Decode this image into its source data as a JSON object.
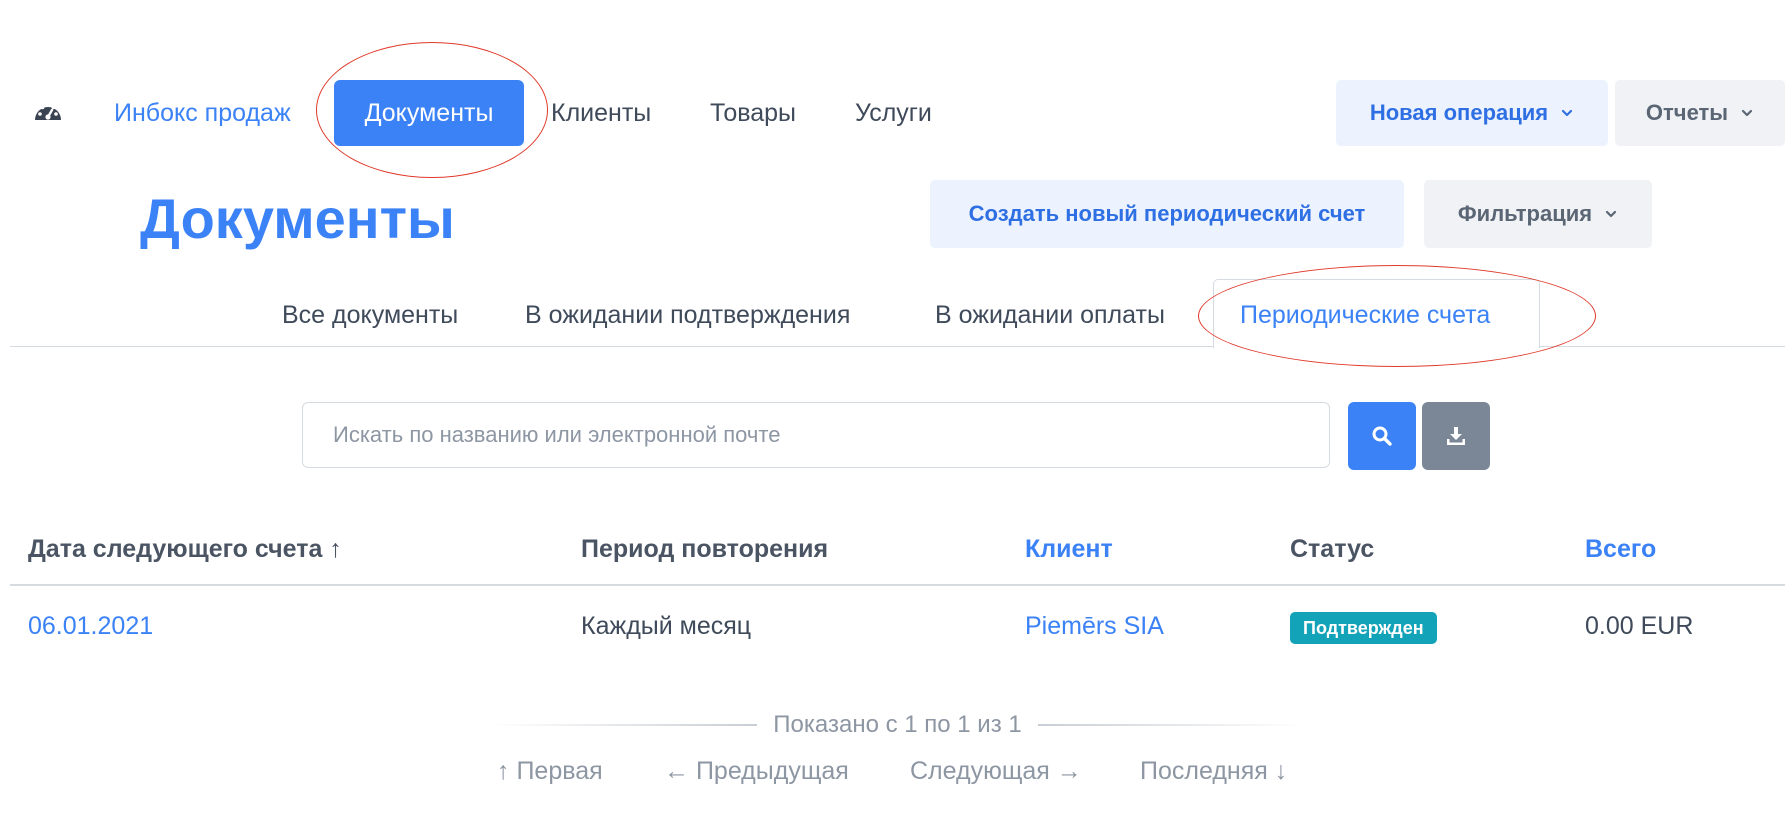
{
  "nav": {
    "dashboard_icon": "speedometer-icon",
    "sales_inbox": "Инбокс продаж",
    "documents": "Документы",
    "clients": "Клиенты",
    "products": "Товары",
    "services": "Услуги",
    "new_operation": "Новая операция",
    "reports": "Отчеты"
  },
  "page": {
    "title": "Документы",
    "create_button": "Создать новый периодический счет",
    "filter_button": "Фильтрация"
  },
  "tabs": [
    {
      "label": "Все документы"
    },
    {
      "label": "В ожидании подтверждения"
    },
    {
      "label": "В ожидании оплаты"
    },
    {
      "label": "Периодические счета",
      "active": true
    }
  ],
  "search": {
    "placeholder": "Искать по названию или электронной почте",
    "search_icon": "magnifier-icon",
    "download_icon": "download-icon"
  },
  "table": {
    "headers": [
      "Дата следующего счета ↑",
      "Период повторения",
      "Клиент",
      "Статус",
      "Всего"
    ],
    "rows": [
      {
        "date": "06.01.2021",
        "period": "Каждый месяц",
        "client": "Piemērs SIA",
        "status": "Подтвержден",
        "total": "0.00 EUR"
      }
    ]
  },
  "pagination": {
    "summary": "Показано с 1 по 1 из 1",
    "first": "↑ Первая",
    "prev": "← Предыдущая",
    "next": "Следующая →",
    "last": "Последняя ↓"
  },
  "colors": {
    "primary": "#3b82f6",
    "annotation": "#e03a2b",
    "status_badge": "#13a3b8",
    "download_button": "#7b8797"
  }
}
